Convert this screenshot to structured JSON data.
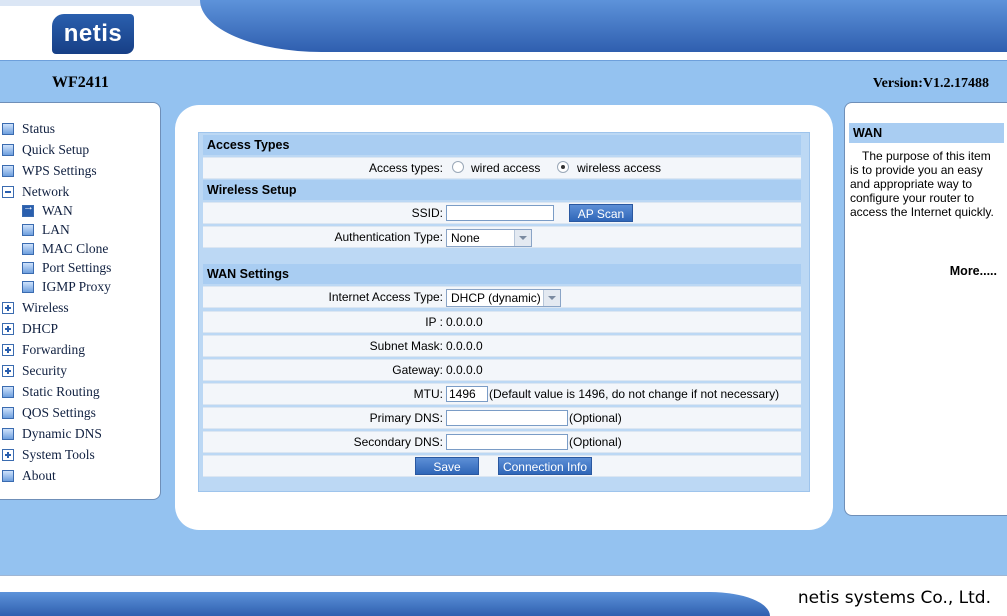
{
  "header": {
    "logo_text": "netis",
    "model": "WF2411",
    "version": "Version:V1.2.17488"
  },
  "nav": {
    "items": [
      {
        "label": "Status",
        "icon": "page-icon"
      },
      {
        "label": "Quick Setup",
        "icon": "page-icon"
      },
      {
        "label": "WPS Settings",
        "icon": "page-icon"
      },
      {
        "label": "Network",
        "icon": "minus-icon"
      },
      {
        "label": "WAN",
        "icon": "arrow-icon"
      },
      {
        "label": "LAN",
        "icon": "page-icon"
      },
      {
        "label": "MAC Clone",
        "icon": "page-icon"
      },
      {
        "label": "Port Settings",
        "icon": "page-icon"
      },
      {
        "label": "IGMP Proxy",
        "icon": "page-icon"
      },
      {
        "label": "Wireless",
        "icon": "plus-icon"
      },
      {
        "label": "DHCP",
        "icon": "plus-icon"
      },
      {
        "label": "Forwarding",
        "icon": "plus-icon"
      },
      {
        "label": "Security",
        "icon": "plus-icon"
      },
      {
        "label": "Static Routing",
        "icon": "page-icon"
      },
      {
        "label": "QOS Settings",
        "icon": "page-icon"
      },
      {
        "label": "Dynamic DNS",
        "icon": "page-icon"
      },
      {
        "label": "System Tools",
        "icon": "plus-icon"
      },
      {
        "label": "About",
        "icon": "page-icon"
      }
    ]
  },
  "main": {
    "access_types": {
      "title": "Access Types",
      "label": "Access types:",
      "wired": "wired access",
      "wireless": "wireless access",
      "selected": "wireless"
    },
    "wireless_setup": {
      "title": "Wireless Setup",
      "ssid_label": "SSID:",
      "ssid_value": "",
      "ap_scan": "AP Scan",
      "auth_label": "Authentication Type:",
      "auth_value": "None"
    },
    "wan_settings": {
      "title": "WAN Settings",
      "access_type_label": "Internet Access Type:",
      "access_type_value": "DHCP (dynamic)",
      "ip_label": "IP :",
      "ip_value": "0.0.0.0",
      "mask_label": "Subnet Mask:",
      "mask_value": "0.0.0.0",
      "gw_label": "Gateway:",
      "gw_value": "0.0.0.0",
      "mtu_label": "MTU:",
      "mtu_value": "1496",
      "mtu_note": "(Default value is 1496, do not change if not necessary)",
      "dns1_label": "Primary DNS:",
      "dns1_value": "",
      "dns2_label": "Secondary DNS:",
      "dns2_value": "",
      "optional": "(Optional)"
    },
    "buttons": {
      "save": "Save",
      "connection_info": "Connection Info"
    }
  },
  "help": {
    "title": "WAN",
    "text": "The purpose of this item is to provide you an easy and appropriate way to configure your router to access the Internet quickly.",
    "more": "More....."
  },
  "footer": {
    "company": "netis systems Co., Ltd."
  },
  "colors": {
    "accent": "#2f66b8",
    "section_bg": "#a9cdf2",
    "page_bg": "#94c2f0"
  }
}
